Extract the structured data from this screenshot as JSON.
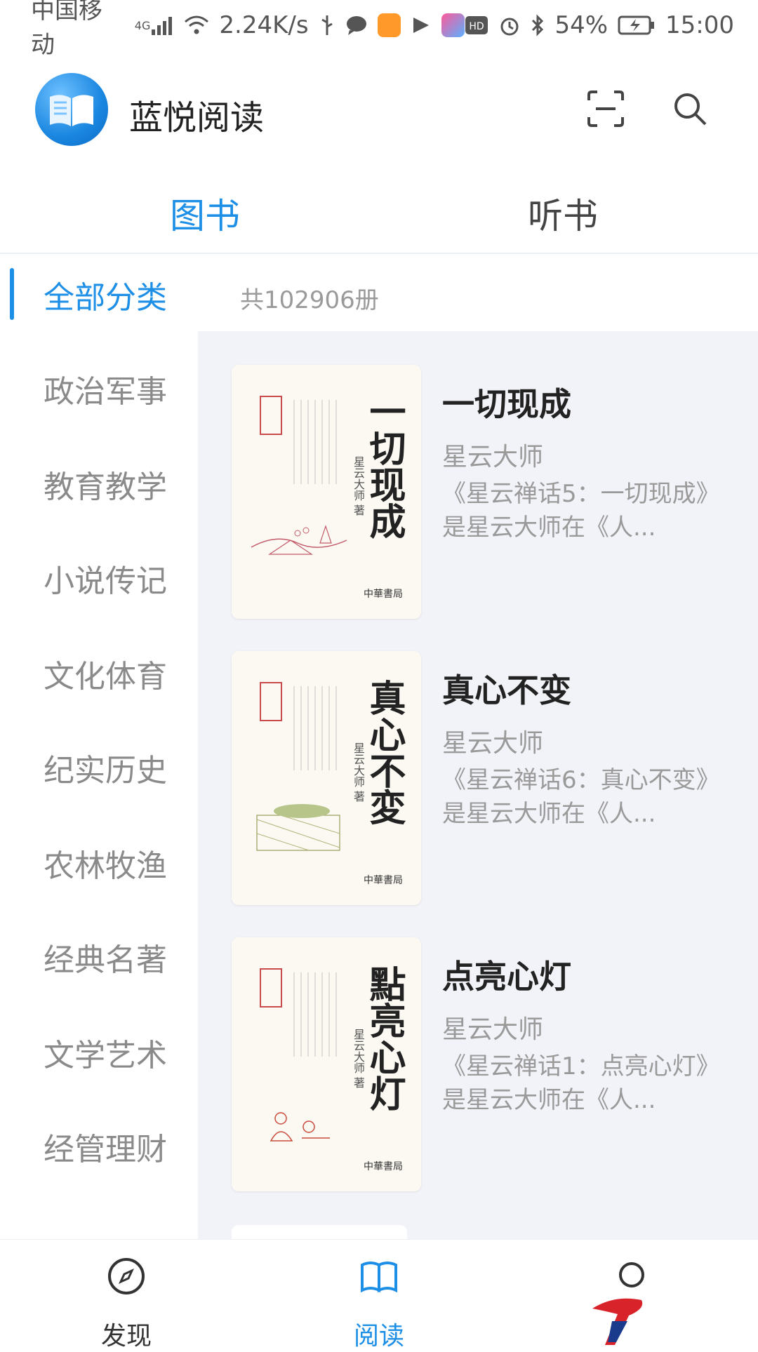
{
  "status_bar": {
    "carrier": "中国移动",
    "network": "4G",
    "speed": "2.24K/s",
    "battery": "54%",
    "time": "15:00"
  },
  "header": {
    "app_name": "蓝悦阅读"
  },
  "tabs": [
    {
      "label": "图书",
      "active": true
    },
    {
      "label": "听书",
      "active": false
    }
  ],
  "sidebar": {
    "items": [
      {
        "label": "全部分类",
        "active": true
      },
      {
        "label": "政治军事"
      },
      {
        "label": "教育教学"
      },
      {
        "label": "小说传记"
      },
      {
        "label": "文化体育"
      },
      {
        "label": "纪实历史"
      },
      {
        "label": "农林牧渔"
      },
      {
        "label": "经典名著"
      },
      {
        "label": "文学艺术"
      },
      {
        "label": "经管理财"
      }
    ]
  },
  "book_count": "共102906册",
  "books": [
    {
      "title": "一切现成",
      "author": "星云大师",
      "desc": "《星云禅话5：一切现成》是星云大师在《人...",
      "cover_title": "一切现成",
      "cover_author": "星云大师 著",
      "publisher": "中華書局"
    },
    {
      "title": "真心不变",
      "author": "星云大师",
      "desc": "《星云禅话6：真心不变》是星云大师在《人...",
      "cover_title": "真心不変",
      "cover_author": "星云大师 著",
      "publisher": "中華書局"
    },
    {
      "title": "点亮心灯",
      "author": "星云大师",
      "desc": "《星云禅话1：点亮心灯》是星云大师在《人...",
      "cover_title": "點亮心灯",
      "cover_author": "星云大师 著",
      "publisher": "中華書局"
    }
  ],
  "bottom_nav": [
    {
      "label": "发现",
      "icon": "compass-icon",
      "active": false
    },
    {
      "label": "阅读",
      "icon": "book-open-icon",
      "active": true
    },
    {
      "label": "",
      "icon": "profile-icon",
      "active": false
    }
  ],
  "colors": {
    "accent": "#1e8fe6",
    "content_bg": "#f2f3f8"
  }
}
